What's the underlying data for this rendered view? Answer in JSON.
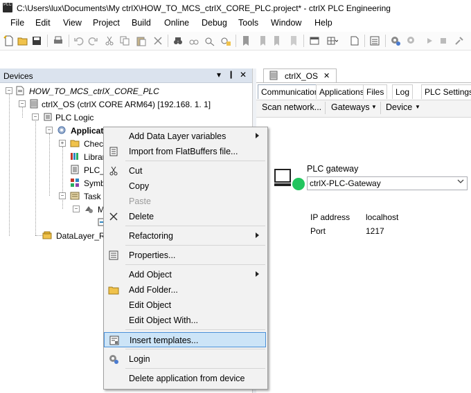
{
  "window": {
    "title": "C:\\Users\\lux\\Documents\\My ctrlX\\HOW_TO_MCS_ctrlX_CORE_PLC.project* - ctrlX PLC Engineering",
    "app_icon_text": "PLC"
  },
  "menubar": [
    "File",
    "Edit",
    "View",
    "Project",
    "Build",
    "Online",
    "Debug",
    "Tools",
    "Window",
    "Help"
  ],
  "devices_panel": {
    "title": "Devices",
    "pin_glyph": "▾",
    "pin2_glyph": "❙",
    "close_glyph": "✕",
    "tree": {
      "project": "HOW_TO_MCS_ctrlX_CORE_PLC",
      "device": "ctrlX_OS (ctrlX CORE ARM64) [192.168. 1. 1]",
      "plc_logic": "PLC Logic",
      "application": "Applicati",
      "check": "Check",
      "library": "Librar",
      "plc_prg": "PLC_P",
      "symbol": "Symbo",
      "task": "Task C",
      "m": "M",
      "datalayer": "DataLayer_Re"
    }
  },
  "editor": {
    "tab_label": "ctrlX_OS",
    "tab_close": "✕",
    "subtabs": [
      "Communication",
      "Applications",
      "Files",
      "Log",
      "PLC Settings"
    ],
    "ribbon": {
      "scan": "Scan network...",
      "gateways": "Gateways",
      "device": "Device"
    },
    "gateway": {
      "label": "PLC gateway",
      "selected": "ctrlX-PLC-Gateway",
      "status_color": "#22c55e",
      "ip_label": "IP address",
      "ip_value": "localhost",
      "port_label": "Port",
      "port_value": "1217"
    }
  },
  "context_menu": {
    "items": [
      {
        "label": "Add Data Layer variables",
        "submenu": true
      },
      {
        "label": "Import from FlatBuffers file...",
        "icon": "import-icon"
      },
      {
        "label": "Cut",
        "icon": "scissors-icon"
      },
      {
        "label": "Copy"
      },
      {
        "label": "Paste",
        "disabled": true
      },
      {
        "label": "Delete",
        "icon": "delete-icon"
      },
      {
        "label": "Refactoring",
        "submenu": true
      },
      {
        "label": "Properties...",
        "icon": "properties-icon"
      },
      {
        "label": "Add Object",
        "submenu": true
      },
      {
        "label": "Add Folder...",
        "icon": "folder-icon"
      },
      {
        "label": "Edit Object"
      },
      {
        "label": "Edit Object With..."
      },
      {
        "label": "Insert templates...",
        "icon": "template-icon",
        "highlighted": true
      },
      {
        "label": "Login",
        "icon": "login-icon"
      },
      {
        "label": "Delete application from device"
      }
    ]
  },
  "colors": {
    "accent": "#0078d7",
    "panel_header": "#dbe3ee",
    "highlight": "#cce4f7"
  }
}
